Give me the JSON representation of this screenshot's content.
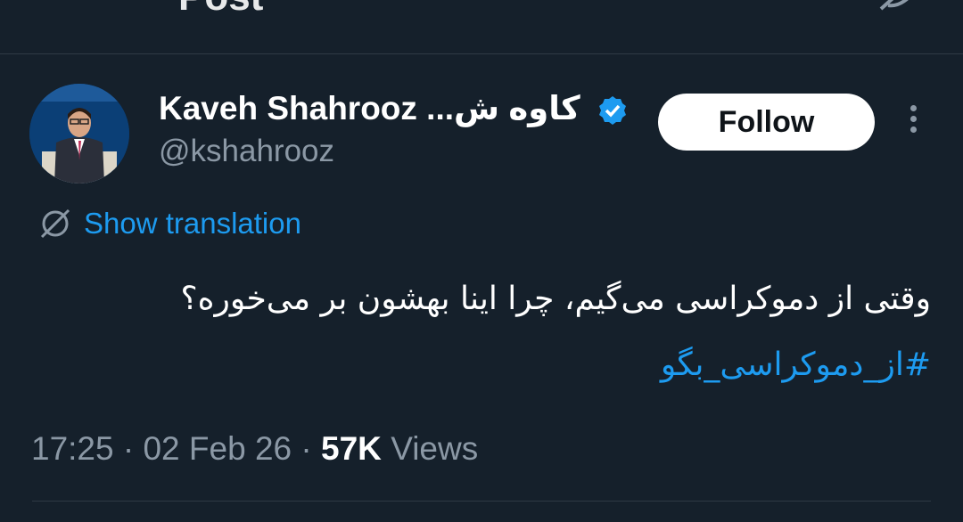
{
  "header": {
    "title": "Post",
    "back_icon": "arrow-left-icon",
    "grok_icon": "grok-icon"
  },
  "author": {
    "display_name": "Kaveh Shahrooz ...کاوه ش",
    "handle": "@kshahrooz",
    "verified_icon": "verified-badge-icon",
    "verified_color": "#1d9bf0"
  },
  "actions": {
    "follow_label": "Follow",
    "more_icon": "more-vertical-icon"
  },
  "translation": {
    "label": "Show translation",
    "icon": "globe-icon"
  },
  "tweet": {
    "text": "وقتی از دموکراسی می‌گیم، چرا اینا بهشون بر می‌خوره؟",
    "hashtag": "#از_دموکراسی_بگو"
  },
  "meta": {
    "time": "17:25",
    "date": "02 Feb 26",
    "views_count": "57K",
    "views_label": "Views",
    "separator": "·"
  },
  "colors": {
    "background": "#15202b",
    "accent": "#1d9bf0",
    "secondary_text": "#8b98a5",
    "divider": "#2f3a45"
  }
}
